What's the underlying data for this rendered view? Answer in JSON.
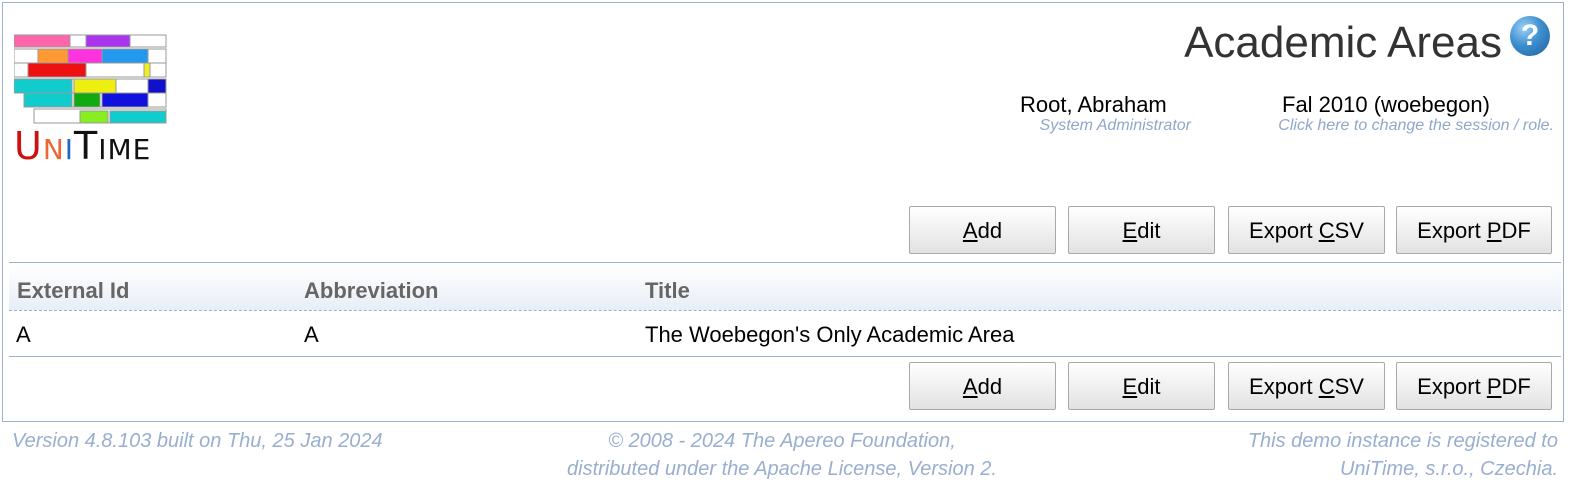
{
  "app": {
    "logo_parts": [
      "U",
      "N",
      "I",
      "T",
      "IME"
    ],
    "logo_alt": "UniTime"
  },
  "header": {
    "title": "Academic Areas",
    "help_icon": "question-circle-icon"
  },
  "user": {
    "name": "Root, Abraham",
    "role": "System Administrator"
  },
  "session": {
    "name": "Fal 2010 (woebegon)",
    "hint": "Click here to change the session / role."
  },
  "buttons": {
    "add_u": "A",
    "add_rest": "dd",
    "edit_u": "E",
    "edit_rest": "dit",
    "csv_pre": "Export ",
    "csv_u": "C",
    "csv_rest": "SV",
    "pdf_pre": "Export ",
    "pdf_u": "P",
    "pdf_rest": "DF"
  },
  "table": {
    "columns": [
      "External Id",
      "Abbreviation",
      "Title"
    ],
    "rows": [
      {
        "external_id": "A",
        "abbreviation": "A",
        "title": "The Woebegon's Only Academic Area"
      }
    ]
  },
  "footer": {
    "version": "Version 4.8.103 built on Thu, 25 Jan 2024",
    "copyright_1": "© 2008 - 2024 The Apereo Foundation,",
    "copyright_2": "distributed under the Apache License, Version 2.",
    "registered_1": "This demo instance is registered to",
    "registered_2": "UniTime, s.r.o., Czechia."
  }
}
